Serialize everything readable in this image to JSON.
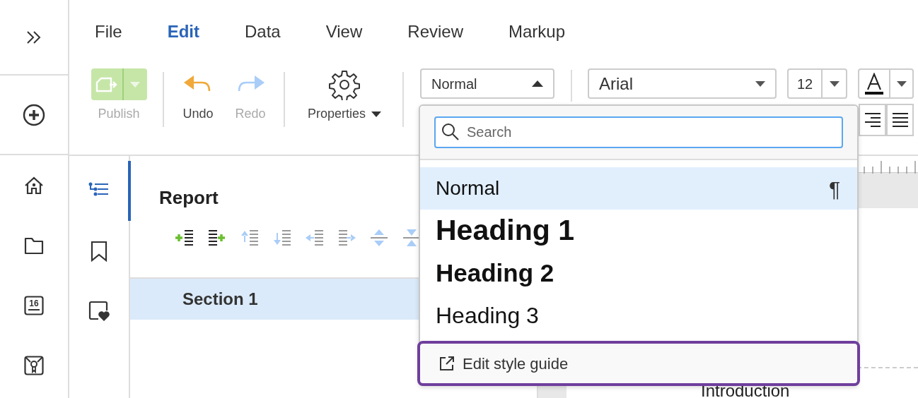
{
  "rail": {
    "calendar_day": "16"
  },
  "menu": [
    {
      "label": "File",
      "selected": false
    },
    {
      "label": "Edit",
      "selected": true
    },
    {
      "label": "Data",
      "selected": false
    },
    {
      "label": "View",
      "selected": false
    },
    {
      "label": "Review",
      "selected": false
    },
    {
      "label": "Markup",
      "selected": false
    }
  ],
  "toolbar": {
    "publish": {
      "label": "Publish",
      "disabled": true
    },
    "undo": {
      "label": "Undo",
      "disabled": false
    },
    "redo": {
      "label": "Redo",
      "disabled": true
    },
    "properties": {
      "label": "Properties"
    },
    "style_select": {
      "value": "Normal",
      "expanded": true
    },
    "font_select": {
      "value": "Arial"
    },
    "size_select": {
      "value": "12"
    }
  },
  "nav_tabs": [
    {
      "kind": "outline",
      "selected": true
    },
    {
      "kind": "bookmark",
      "selected": false
    },
    {
      "kind": "favorites",
      "selected": false
    }
  ],
  "outline": {
    "title": "Report",
    "sections": [
      {
        "label": "Section 1",
        "selected": true
      }
    ]
  },
  "document": {
    "heading": "Introduction"
  },
  "style_menu": {
    "search": {
      "placeholder": "Search"
    },
    "styles": [
      {
        "label": "Normal",
        "kind": "normal",
        "selected": true,
        "symbol": "¶"
      },
      {
        "label": "Heading 1",
        "kind": "h1",
        "selected": false
      },
      {
        "label": "Heading 2",
        "kind": "h2",
        "selected": false
      },
      {
        "label": "Heading 3",
        "kind": "h3",
        "selected": false
      }
    ],
    "footer": {
      "label": "Edit style guide",
      "highlighted": true
    }
  }
}
